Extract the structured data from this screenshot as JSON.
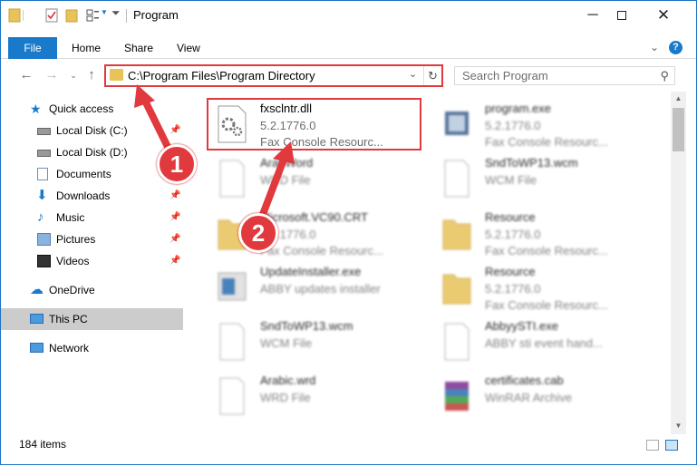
{
  "window": {
    "title": "Program",
    "controls": {
      "minimize_icon": "minimize-icon",
      "maximize_icon": "maximize-icon",
      "close_icon": "close-icon"
    }
  },
  "ribbon": {
    "tabs": [
      {
        "label": "File",
        "active": true
      },
      {
        "label": "Home"
      },
      {
        "label": "Share"
      },
      {
        "label": "View"
      }
    ]
  },
  "address": {
    "path": "C:\\Program Files\\Program Directory"
  },
  "search": {
    "placeholder": "Search Program"
  },
  "nav": {
    "items": [
      {
        "label": "Quick access",
        "icon": "star-icon",
        "pinned": false
      },
      {
        "label": "Local Disk (C:)",
        "icon": "drive-icon",
        "pinned": true
      },
      {
        "label": "Local Disk (D:)",
        "icon": "drive-icon",
        "pinned": false
      },
      {
        "label": "Documents",
        "icon": "documents-icon",
        "pinned": true
      },
      {
        "label": "Downloads",
        "icon": "downloads-icon",
        "pinned": true
      },
      {
        "label": "Music",
        "icon": "music-icon",
        "pinned": true
      },
      {
        "label": "Pictures",
        "icon": "pictures-icon",
        "pinned": true
      },
      {
        "label": "Videos",
        "icon": "videos-icon",
        "pinned": true
      },
      {
        "label": "OneDrive",
        "icon": "onedrive-icon",
        "pinned": false
      },
      {
        "label": "This PC",
        "icon": "this-pc-icon",
        "pinned": false,
        "selected": true
      },
      {
        "label": "Network",
        "icon": "network-icon",
        "pinned": false
      }
    ]
  },
  "files": [
    {
      "name": "fxsclntr.dll",
      "line2": "5.2.1776.0",
      "line3": "Fax Console Resourc...",
      "icon": "dll-gear-icon"
    },
    {
      "name": "program.exe",
      "line2": "5.2.1776.0",
      "line3": "Fax Console Resourc...",
      "icon": "exe-icon"
    },
    {
      "name": "ArabWord",
      "line2": "WRD File",
      "line3": "",
      "icon": "blank-file-icon"
    },
    {
      "name": "SndToWP13.wcm",
      "line2": "WCM File",
      "line3": "",
      "icon": "blank-file-icon"
    },
    {
      "name": "Microsoft.VC90.CRT",
      "line2": "5.2.1776.0",
      "line3": "Fax Console Resourc...",
      "icon": "folder-icon"
    },
    {
      "name": "Resource",
      "line2": "5.2.1776.0",
      "line3": "Fax Console Resourc...",
      "icon": "folder-icon"
    },
    {
      "name": "UpdateInstaller.exe",
      "line2": "ABBY updates installer",
      "line3": "",
      "icon": "installer-icon"
    },
    {
      "name": "Resource",
      "line2": "5.2.1776.0",
      "line3": "Fax Console Resourc...",
      "icon": "folder-icon"
    },
    {
      "name": "SndToWP13.wcm",
      "line2": "WCM File",
      "line3": "",
      "icon": "blank-file-icon"
    },
    {
      "name": "AbbyySTI.exe",
      "line2": "ABBY sti event hand...",
      "line3": "",
      "icon": "blank-file-icon"
    },
    {
      "name": "Arabic.wrd",
      "line2": "WRD File",
      "line3": "",
      "icon": "blank-file-icon"
    },
    {
      "name": "certificates.cab",
      "line2": "WinRAR Archive",
      "line3": "",
      "icon": "winrar-icon"
    }
  ],
  "status": {
    "items_count": "184 items"
  },
  "annotations": {
    "badge1": "1",
    "badge2": "2"
  },
  "colors": {
    "accent": "#1979ca",
    "highlight": "#e0393e",
    "folder": "#e8c35a"
  }
}
